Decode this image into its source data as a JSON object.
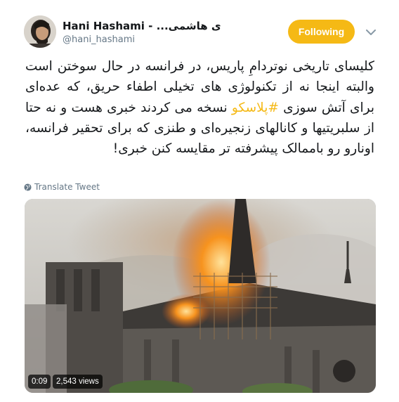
{
  "author": {
    "display_name": "Hani Hashami - ...ی هاشمی",
    "handle": "@hani_hashami",
    "avatar_icon": "user-avatar"
  },
  "follow_button": {
    "label": "Following",
    "color": "#f5b915"
  },
  "more_menu_icon": "chevron-down-icon",
  "tweet": {
    "text_before": "کلیسای تاریخی نوتردامِ پاریس، در فرانسه در حال سوختن است والبته اینجا نه از تکنولوژی های تخیلی اطفاء حریق، که عده‌ای برای آتش سوزی ",
    "hashtag": "#پلاسکو",
    "text_after": " نسخه می کردند خبری هست و نه حتا از سلبریتیها و کانالهای زنجیره‌ای و طنزی که برای تحقیر فرانسه، اونارو رو باممالک پیشرفته تر مقایسه کنن خبری!"
  },
  "translate": {
    "label": "Translate Tweet",
    "icon": "globe-icon"
  },
  "video": {
    "duration": "0:09",
    "views": "2,543 views"
  },
  "colors": {
    "accent": "#f5b915",
    "secondary_text": "#657786"
  }
}
